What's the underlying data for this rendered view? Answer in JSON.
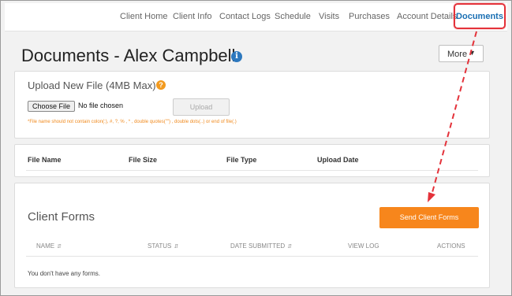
{
  "nav": {
    "items": [
      {
        "label": "Client Home"
      },
      {
        "label": "Client Info"
      },
      {
        "label": "Contact Logs"
      },
      {
        "label": "Schedule"
      },
      {
        "label": "Visits"
      },
      {
        "label": "Purchases"
      },
      {
        "label": "Account Details"
      }
    ],
    "active_label": "Documents"
  },
  "header": {
    "title": "Documents - Alex Campbell",
    "info_icon": "info-icon",
    "more_label": "More"
  },
  "upload": {
    "title": "Upload New File (4MB Max)",
    "choose_label": "Choose File",
    "file_status": "No file chosen",
    "upload_label": "Upload",
    "hint": "*File name should not contain colon(:), #, ?, % , * , double quotes(\"\") , double dots(..) or end of file(.)"
  },
  "files_table": {
    "columns": [
      "File Name",
      "File Size",
      "File Type",
      "Upload Date"
    ]
  },
  "client_forms": {
    "title": "Client Forms",
    "send_label": "Send Client Forms",
    "columns": [
      {
        "label": "NAME",
        "sortable": true
      },
      {
        "label": "STATUS",
        "sortable": true
      },
      {
        "label": "DATE SUBMITTED",
        "sortable": true
      },
      {
        "label": "VIEW LOG",
        "sortable": false
      },
      {
        "label": "ACTIONS",
        "sortable": false
      }
    ],
    "empty_message": "You don't have any forms."
  },
  "colors": {
    "accent_orange": "#f7861c",
    "highlight_red": "#e4323a",
    "link_blue": "#1a6fb3"
  }
}
